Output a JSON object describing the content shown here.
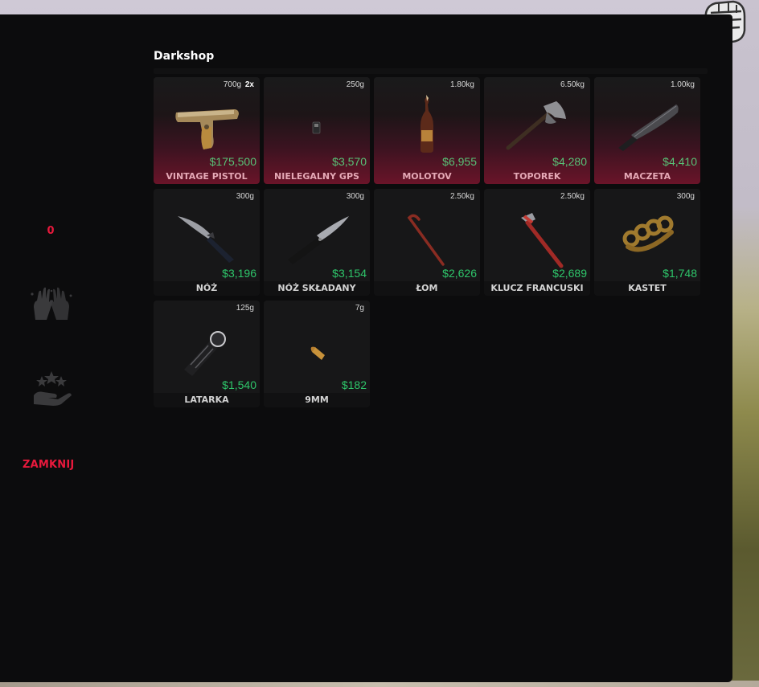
{
  "shop": {
    "title": "Darkshop",
    "badge_count": "0",
    "close_label": "ZAMKNIJ"
  },
  "colors": {
    "accent": "#e8193c",
    "price": "#2ec56a",
    "panel": "#0c0c0d",
    "card": "#171718",
    "featured_gradient_end": "#6a1429"
  },
  "icons": {
    "hands": "hands-icon",
    "stars": "stars-hand-icon",
    "fist": "fist-icon"
  },
  "items": [
    {
      "name": "VINTAGE PISTOL",
      "weight": "700g",
      "qty": "2x",
      "price": "$175,500",
      "featured": true,
      "icon": "pistol-icon"
    },
    {
      "name": "NIELEGALNY GPS",
      "weight": "250g",
      "qty": "",
      "price": "$3,570",
      "featured": true,
      "icon": "gps-icon"
    },
    {
      "name": "MOLOTOV",
      "weight": "1.80kg",
      "qty": "",
      "price": "$6,955",
      "featured": true,
      "icon": "molotov-icon"
    },
    {
      "name": "TOPOREK",
      "weight": "6.50kg",
      "qty": "",
      "price": "$4,280",
      "featured": true,
      "icon": "hatchet-icon"
    },
    {
      "name": "MACZETA",
      "weight": "1.00kg",
      "qty": "",
      "price": "$4,410",
      "featured": true,
      "icon": "machete-icon"
    },
    {
      "name": "NÓŻ",
      "weight": "300g",
      "qty": "",
      "price": "$3,196",
      "featured": false,
      "icon": "knife-icon"
    },
    {
      "name": "NÓŻ SKŁADANY",
      "weight": "300g",
      "qty": "",
      "price": "$3,154",
      "featured": false,
      "icon": "switchblade-icon"
    },
    {
      "name": "ŁOM",
      "weight": "2.50kg",
      "qty": "",
      "price": "$2,626",
      "featured": false,
      "icon": "crowbar-icon"
    },
    {
      "name": "KLUCZ FRANCUSKI",
      "weight": "2.50kg",
      "qty": "",
      "price": "$2,689",
      "featured": false,
      "icon": "wrench-icon"
    },
    {
      "name": "KASTET",
      "weight": "300g",
      "qty": "",
      "price": "$1,748",
      "featured": false,
      "icon": "knuckles-icon"
    },
    {
      "name": "LATARKA",
      "weight": "125g",
      "qty": "",
      "price": "$1,540",
      "featured": false,
      "icon": "flashlight-icon"
    },
    {
      "name": "9MM",
      "weight": "7g",
      "qty": "",
      "price": "$182",
      "featured": false,
      "icon": "ammo-icon"
    }
  ]
}
